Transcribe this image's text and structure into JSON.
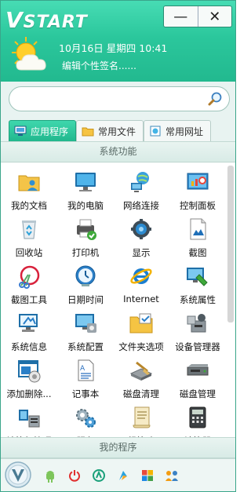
{
  "app": {
    "logo": "VSTART",
    "logo_first": "V",
    "logo_rest": "START"
  },
  "window_buttons": {
    "minimize": "—",
    "close": "✕"
  },
  "header": {
    "date": "10月16日",
    "weekday": "星期四",
    "time": "10:41",
    "signature": "编辑个性签名......"
  },
  "search": {
    "placeholder": "",
    "value": ""
  },
  "tabs": [
    {
      "label": "应用程序",
      "active": true
    },
    {
      "label": "常用文件",
      "active": false
    },
    {
      "label": "常用网址",
      "active": false
    }
  ],
  "section_title": "系统功能",
  "apps": [
    {
      "label": "我的文档",
      "icon": "documents-icon"
    },
    {
      "label": "我的电脑",
      "icon": "computer-icon"
    },
    {
      "label": "网络连接",
      "icon": "network-icon"
    },
    {
      "label": "控制面板",
      "icon": "control-panel-icon"
    },
    {
      "label": "回收站",
      "icon": "recycle-bin-icon"
    },
    {
      "label": "打印机",
      "icon": "printer-icon"
    },
    {
      "label": "显示",
      "icon": "display-icon"
    },
    {
      "label": "截图",
      "icon": "screenshot-icon"
    },
    {
      "label": "截图工具",
      "icon": "snipping-tool-icon"
    },
    {
      "label": "日期时间",
      "icon": "clock-icon"
    },
    {
      "label": "Internet",
      "icon": "internet-explorer-icon"
    },
    {
      "label": "系统属性",
      "icon": "system-properties-icon"
    },
    {
      "label": "系统信息",
      "icon": "system-info-icon"
    },
    {
      "label": "系统配置",
      "icon": "system-config-icon"
    },
    {
      "label": "文件夹选项",
      "icon": "folder-options-icon"
    },
    {
      "label": "设备管理器",
      "icon": "device-manager-icon"
    },
    {
      "label": "添加删除...",
      "icon": "add-remove-icon"
    },
    {
      "label": "记事本",
      "icon": "notepad-icon"
    },
    {
      "label": "磁盘清理",
      "icon": "disk-cleanup-icon"
    },
    {
      "label": "磁盘管理",
      "icon": "disk-management-icon"
    },
    {
      "label": "计算机管理",
      "icon": "computer-management-icon"
    },
    {
      "label": "服务",
      "icon": "services-icon"
    },
    {
      "label": "组策略",
      "icon": "group-policy-icon"
    },
    {
      "label": "计算器",
      "icon": "calculator-icon"
    }
  ],
  "my_programs_title": "我的程序",
  "dock": [
    {
      "icon": "android-icon"
    },
    {
      "icon": "power-icon"
    },
    {
      "icon": "browser-icon"
    },
    {
      "icon": "bird-icon"
    },
    {
      "icon": "colorful-squares-icon"
    },
    {
      "icon": "people-icon"
    }
  ],
  "colors": {
    "accent": "#2bc79c",
    "accent_dark": "#1ea47e"
  }
}
